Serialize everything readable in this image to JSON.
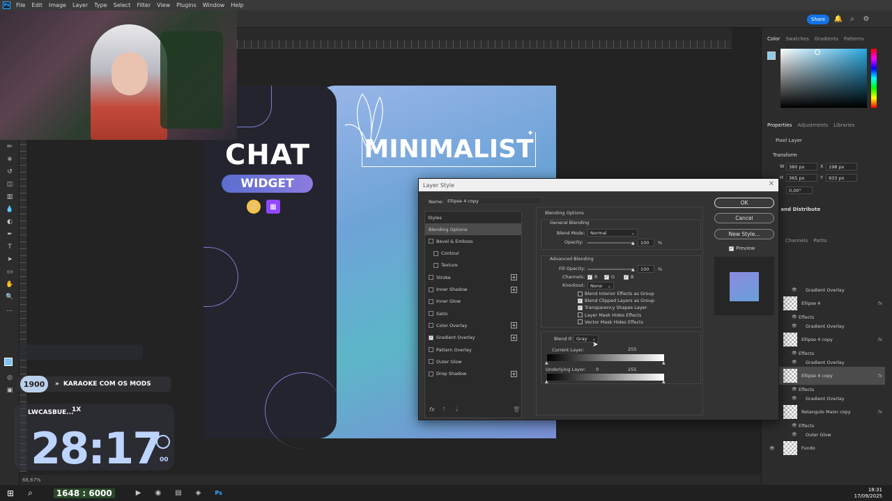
{
  "menu": [
    "File",
    "Edit",
    "Image",
    "Layer",
    "Type",
    "Select",
    "Filter",
    "View",
    "Plugins",
    "Window",
    "Help"
  ],
  "app_logo": "Ps",
  "share_label": "Share",
  "canvas": {
    "chat": "CHAT",
    "widget": "WIDGET",
    "minimalist": "MINIMALIST"
  },
  "overlay": {
    "karaoke_badge": "1900",
    "karaoke_text": "KARAOKE COM OS MODS",
    "timer_label": "LWCASBUE...",
    "timer_multiplier": "1X",
    "timer_value": "28:17",
    "timer_seconds": "00"
  },
  "right_panel": {
    "color_tabs": [
      "Color",
      "Swatches",
      "Gradients",
      "Patterns"
    ],
    "props_tabs": [
      "Properties",
      "Adjustments",
      "Libraries"
    ],
    "pixel_layer": "Pixel Layer",
    "transform": "Transform",
    "w": "380 px",
    "x": "198 px",
    "h": "365 px",
    "y": "933 px",
    "angle": "0,00°",
    "align": "n and Distribute",
    "layer_tabs": [
      "Channels",
      "Paths"
    ]
  },
  "layers": [
    {
      "name": "Gradient Overlay",
      "type": "effect"
    },
    {
      "name": "Ellipse 4",
      "type": "layer"
    },
    {
      "name": "Effects",
      "type": "effect"
    },
    {
      "name": "Gradient Overlay",
      "type": "effect"
    },
    {
      "name": "Ellipse 4 copy",
      "type": "layer"
    },
    {
      "name": "Effects",
      "type": "effect"
    },
    {
      "name": "Gradient Overlay",
      "type": "effect"
    },
    {
      "name": "Ellipse 4 copy",
      "type": "layer"
    },
    {
      "name": "Effects",
      "type": "effect"
    },
    {
      "name": "Gradient Overlay",
      "type": "effect"
    },
    {
      "name": "Retangulo Maior copy",
      "type": "layer"
    },
    {
      "name": "Effects",
      "type": "effect"
    },
    {
      "name": "Outer Glow",
      "type": "effect"
    },
    {
      "name": "Fundo",
      "type": "layer"
    }
  ],
  "dialog": {
    "title": "Layer Style",
    "name_label": "Name:",
    "name_value": "Ellipse 4 copy",
    "styles_header": "Styles",
    "styles": [
      {
        "label": "Blending Options",
        "checkbox": false,
        "plus": false,
        "selected": true,
        "indent": false,
        "checked": false
      },
      {
        "label": "Bevel & Emboss",
        "checkbox": true,
        "plus": false,
        "selected": false,
        "indent": false,
        "checked": false
      },
      {
        "label": "Contour",
        "checkbox": true,
        "plus": false,
        "selected": false,
        "indent": true,
        "checked": false
      },
      {
        "label": "Texture",
        "checkbox": true,
        "plus": false,
        "selected": false,
        "indent": true,
        "checked": false
      },
      {
        "label": "Stroke",
        "checkbox": true,
        "plus": true,
        "selected": false,
        "indent": false,
        "checked": false
      },
      {
        "label": "Inner Shadow",
        "checkbox": true,
        "plus": true,
        "selected": false,
        "indent": false,
        "checked": false
      },
      {
        "label": "Inner Glow",
        "checkbox": true,
        "plus": false,
        "selected": false,
        "indent": false,
        "checked": false
      },
      {
        "label": "Satin",
        "checkbox": true,
        "plus": false,
        "selected": false,
        "indent": false,
        "checked": false
      },
      {
        "label": "Color Overlay",
        "checkbox": true,
        "plus": true,
        "selected": false,
        "indent": false,
        "checked": false
      },
      {
        "label": "Gradient Overlay",
        "checkbox": true,
        "plus": true,
        "selected": false,
        "indent": false,
        "checked": true
      },
      {
        "label": "Pattern Overlay",
        "checkbox": true,
        "plus": false,
        "selected": false,
        "indent": false,
        "checked": false
      },
      {
        "label": "Outer Glow",
        "checkbox": true,
        "plus": false,
        "selected": false,
        "indent": false,
        "checked": false
      },
      {
        "label": "Drop Shadow",
        "checkbox": true,
        "plus": true,
        "selected": false,
        "indent": false,
        "checked": false
      }
    ],
    "blending_options": "Blending Options",
    "general_blending": "General Blending",
    "blend_mode_label": "Blend Mode:",
    "blend_mode_value": "Normal",
    "opacity_label": "Opacity:",
    "opacity_value": "100",
    "percent": "%",
    "advanced_blending": "Advanced Blending",
    "fill_opacity_label": "Fill Opacity:",
    "fill_opacity_value": "100",
    "channels_label": "Channels:",
    "channel_r": "R",
    "channel_g": "G",
    "channel_b": "B",
    "knockout_label": "Knockout:",
    "knockout_value": "None",
    "adv_options": [
      {
        "label": "Blend Interior Effects as Group",
        "checked": false
      },
      {
        "label": "Blend Clipped Layers as Group",
        "checked": true
      },
      {
        "label": "Transparency Shapes Layer",
        "checked": true
      },
      {
        "label": "Layer Mask Hides Effects",
        "checked": false
      },
      {
        "label": "Vector Mask Hides Effects",
        "checked": false
      }
    ],
    "blend_if_label": "Blend If:",
    "blend_if_value": "Gray",
    "current_layer_label": "Current Layer:",
    "current_layer_max": "255",
    "underlying_label": "Underlying Layer:",
    "underlying_min": "0",
    "underlying_max": "255",
    "ok": "OK",
    "cancel": "Cancel",
    "new_style": "New Style...",
    "preview": "Preview"
  },
  "taskbar": {
    "score": "1648 : 6000",
    "time": "18:31",
    "date": "17/09/2025"
  },
  "zoom": "66,67%"
}
